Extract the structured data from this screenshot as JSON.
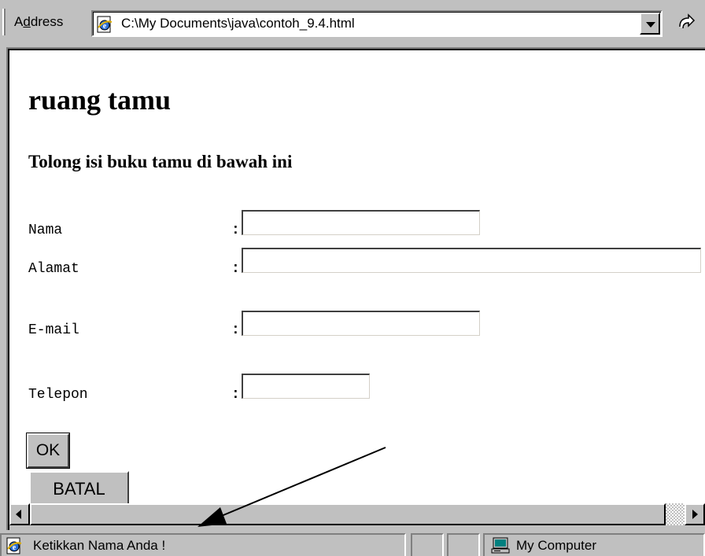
{
  "address_bar": {
    "label": "Address",
    "accesskey_letter": "d",
    "url": "C:\\My Documents\\java\\contoh_9.4.html"
  },
  "page": {
    "heading": "ruang tamu",
    "subheading": "Tolong isi buku tamu di bawah ini",
    "form": {
      "colon": ":",
      "fields": [
        {
          "label": "Nama",
          "value": ""
        },
        {
          "label": "Alamat",
          "value": ""
        },
        {
          "label": "E-mail",
          "value": ""
        },
        {
          "label": "Telepon",
          "value": ""
        }
      ],
      "ok_label": "OK",
      "batal_label": "BATAL"
    }
  },
  "status_bar": {
    "message": "Ketikkan Nama Anda !",
    "zone": "My Computer"
  },
  "icons": {
    "address_page": "ie-page-icon",
    "go": "go-arrow-icon",
    "status_page": "ie-page-icon",
    "zone": "my-computer-icon"
  },
  "colors": {
    "chrome": "#c0c0c0",
    "page_background": "#ffffff",
    "text": "#000000"
  }
}
